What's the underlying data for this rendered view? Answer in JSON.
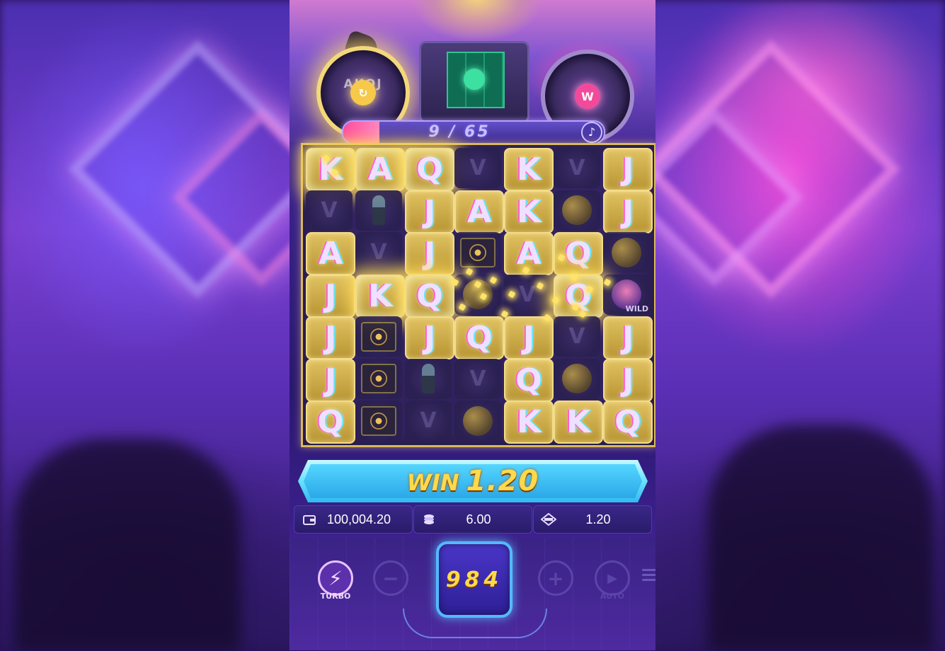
{
  "game": {
    "tumble_progress": {
      "current": "9",
      "separator": "/",
      "total": "65",
      "fill": 0.1385
    },
    "turntable_left": {
      "label": "AKQJ",
      "center_icon": "refresh-icon"
    },
    "turntable_right": {
      "center_letter": "W"
    },
    "note_icon": "music-note-icon",
    "grid": {
      "rows": [
        [
          "K",
          "A",
          "Q",
          "headphones",
          "K",
          "headphones",
          "J"
        ],
        [
          "headphones",
          "mic",
          "J",
          "A",
          "K",
          "discoball",
          "J"
        ],
        [
          "A",
          "headphones",
          "J",
          "deck",
          "A",
          "Q",
          "discoball"
        ],
        [
          "J",
          "K",
          "Q",
          "discoball",
          "headphones",
          "Q",
          "wild"
        ],
        [
          "J",
          "deck",
          "J",
          "Q",
          "J",
          "headphones",
          "J"
        ],
        [
          "J",
          "deck",
          "mic",
          "headphones",
          "Q",
          "discoball",
          "J"
        ],
        [
          "Q",
          "deck",
          "headphones",
          "discoball",
          "K",
          "K",
          "Q"
        ]
      ],
      "wild_label": "WILD"
    },
    "win_banner": {
      "label": "WIN",
      "amount": "1.20"
    },
    "stats": {
      "balance": "100,004.20",
      "bet": "6.00",
      "win": "1.20"
    },
    "stat_icons": {
      "balance": "wallet-icon",
      "bet": "coin-stack-icon",
      "win": "win-badge-icon"
    },
    "controls": {
      "turbo_label": "TURBO",
      "auto_label": "AUTO",
      "spin_display": "984"
    },
    "colors": {
      "gold": "#ffd94a",
      "banner": "#55d6ff",
      "tile": "#e0c160",
      "progress_fill": "#ff4ba0"
    }
  }
}
